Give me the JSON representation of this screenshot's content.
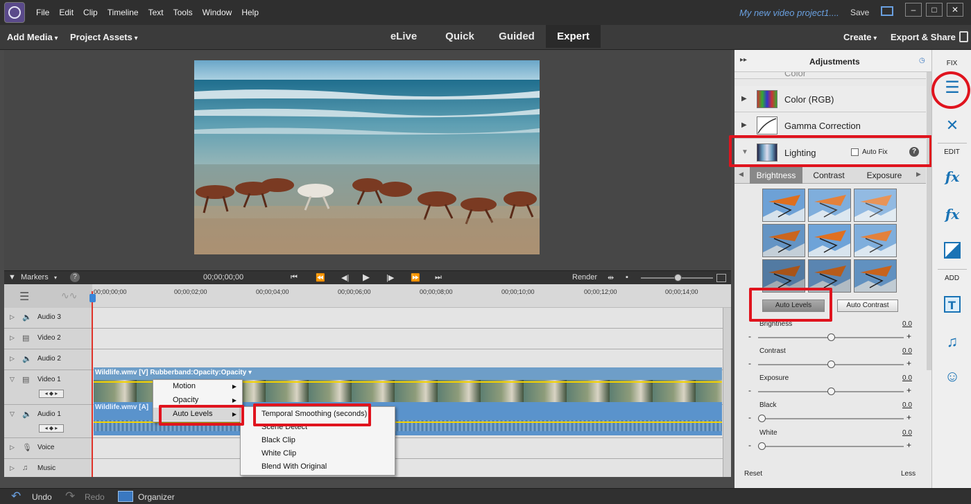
{
  "menu": {
    "items": [
      "File",
      "Edit",
      "Clip",
      "Timeline",
      "Text",
      "Tools",
      "Window",
      "Help"
    ],
    "project_title": "My new video project1....",
    "save": "Save"
  },
  "window_controls": [
    "–",
    "□",
    "✕"
  ],
  "modebar": {
    "add_media": "Add Media",
    "project_assets": "Project Assets",
    "tabs": [
      "eLive",
      "Quick",
      "Guided",
      "Expert"
    ],
    "active_tab": "Expert",
    "create": "Create",
    "export_share": "Export & Share"
  },
  "transport": {
    "markers": "Markers",
    "timecode": "00;00;00;00",
    "render": "Render",
    "help": "?"
  },
  "ruler_ticks": [
    "00;00;00;00",
    "00;00;02;00",
    "00;00;04;00",
    "00;00;06;00",
    "00;00;08;00",
    "00;00;10;00",
    "00;00;12;00",
    "00;00;14;00"
  ],
  "tracks": [
    "Audio 3",
    "Video 2",
    "Audio 2",
    "Video 1",
    "Audio 1",
    "Voice",
    "Music"
  ],
  "clips": {
    "video_label": "Wildlife.wmv [V] Rubberband:Opacity:Opacity ▾",
    "audio_label": "Wildlife.wmv [A]"
  },
  "context_menu": {
    "items": [
      "Motion",
      "Opacity",
      "Auto Levels"
    ]
  },
  "submenu": {
    "items": [
      "Temporal Smoothing (seconds)",
      "Scene Detect",
      "Black Clip",
      "White Clip",
      "Blend With Original"
    ]
  },
  "bottombar": {
    "undo": "Undo",
    "redo": "Redo",
    "organizer": "Organizer"
  },
  "panel": {
    "title": "Adjustments",
    "rows": [
      "Color",
      "Color (RGB)",
      "Gamma Correction",
      "Lighting"
    ],
    "auto_fix": "Auto Fix",
    "help": "?",
    "subtabs": [
      "Brightness",
      "Contrast",
      "Exposure"
    ],
    "active_subtab": "Brightness",
    "auto_levels": "Auto Levels",
    "auto_contrast": "Auto Contrast",
    "sliders": [
      {
        "label": "Brightness",
        "value": "0.0",
        "level": 0.5
      },
      {
        "label": "Contrast",
        "value": "0.0",
        "level": 0.5
      },
      {
        "label": "Exposure",
        "value": "0.0",
        "level": 0.5
      },
      {
        "label": "Black",
        "value": "0.0",
        "level": 0.0
      },
      {
        "label": "White",
        "value": "0.0",
        "level": 0.0
      }
    ],
    "reset": "Reset",
    "less": "Less"
  },
  "right_toolbar": {
    "fix": "FIX",
    "edit": "EDIT",
    "add": "ADD"
  },
  "colors": {
    "highlight_red": "#e0141e",
    "clip_blue": "#6e9ec8",
    "playhead": "#e0332a",
    "tool_blue": "#1a73b5"
  }
}
